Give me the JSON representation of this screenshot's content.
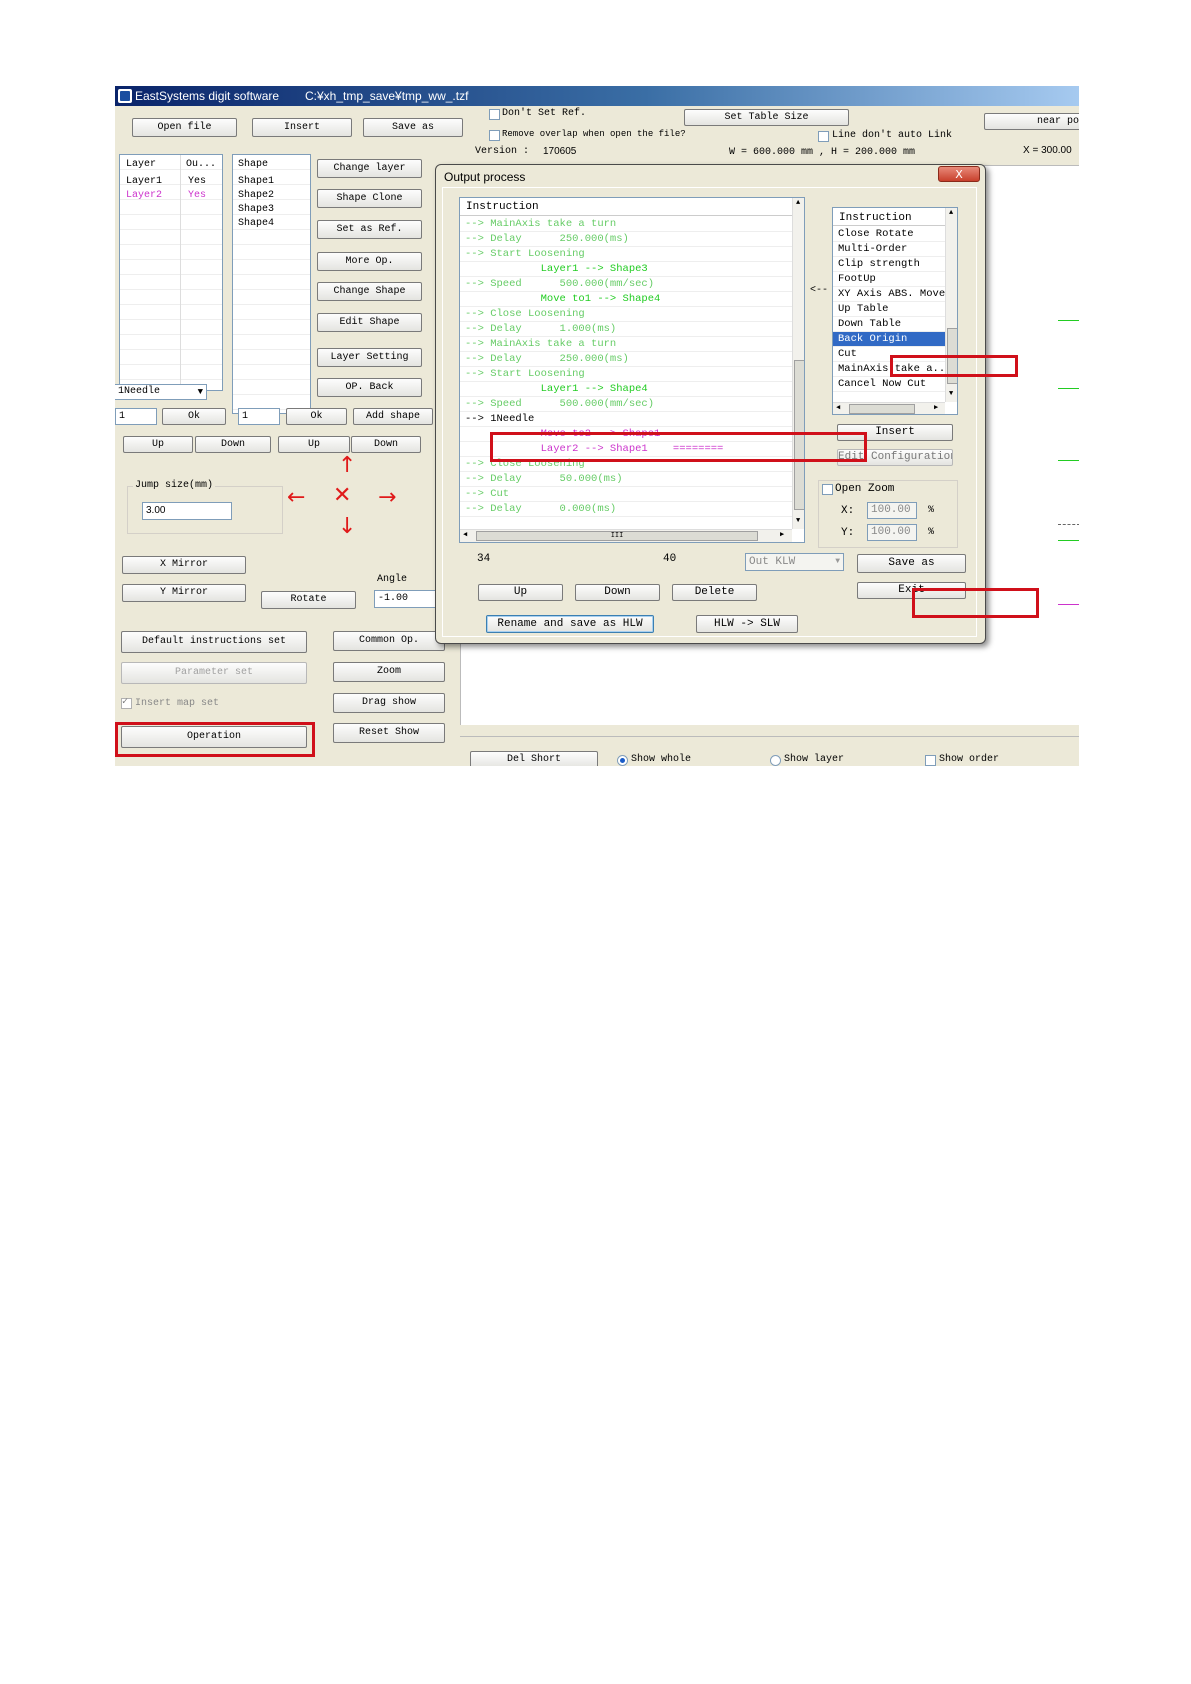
{
  "window": {
    "app_title": "EastSystems digit software",
    "file_path": "C:¥xh_tmp_save¥tmp_ww_.tzf"
  },
  "top": {
    "dont_set_ref": "Don't Set Ref.",
    "remove_overlap": "Remove overlap when open the file?",
    "set_table_size": "Set Table Size",
    "line_dont_auto_link": "Line don't auto Link",
    "near_btn": "near po",
    "version_label": "Version :",
    "version_value": "170605",
    "table_dims": "W = 600.000 mm , H = 200.000 mm",
    "x_value": "X = 300.00"
  },
  "toolbar": {
    "open_file": "Open file",
    "insert": "Insert",
    "save_as": "Save as"
  },
  "layers": {
    "col_layer": "Layer",
    "col_out": "Ou...",
    "rows": [
      {
        "name": "Layer1",
        "out": "Yes"
      },
      {
        "name": "Layer2",
        "out": "Yes"
      }
    ],
    "layer_color": "#000000",
    "layer2_color": "#cc33cc"
  },
  "shapes": {
    "col_shape": "Shape",
    "rows": [
      "Shape1",
      "Shape2",
      "Shape3",
      "Shape4"
    ]
  },
  "side_buttons": [
    "Change layer",
    "Shape Clone",
    "Set as Ref.",
    "More Op.",
    "Change Shape",
    "Edit Shape",
    "Layer Setting",
    "OP. Back"
  ],
  "needle_select": "1Needle",
  "count1": "1",
  "ok1": "Ok",
  "count2": "1",
  "ok2": "Ok",
  "add_shape": "Add shape",
  "up1": "Up",
  "down1": "Down",
  "up2": "Up",
  "down2": "Down",
  "jump": {
    "label": "Jump size(mm)",
    "value": "3.00"
  },
  "x_mirror": "X Mirror",
  "y_mirror": "Y Mirror",
  "rotate": "Rotate",
  "angle": {
    "label": "Angle",
    "value": "-1.00"
  },
  "bottom_left": {
    "default_instructions": "Default instructions set",
    "parameter_set": "Parameter set",
    "insert_map_set": "Insert map set",
    "operation": "Operation"
  },
  "bottom_mid": [
    "Common Op.",
    "Zoom",
    "Drag show",
    "Reset Show"
  ],
  "bottom_strip": {
    "del_short": "Del Short",
    "show_whole": "Show whole",
    "show_layer": "Show layer",
    "show_order": "Show order"
  },
  "dialog": {
    "title": "Output process",
    "close_label": "X",
    "instruction_header": "Instruction",
    "instructions": [
      {
        "text": "--> MainAxis take a turn",
        "color": "#66cc66"
      },
      {
        "text": "--> Delay      250.000(ms)",
        "color": "#66cc66"
      },
      {
        "text": "--> Start Loosening",
        "color": "#66cc66"
      },
      {
        "text": "            Layer1 --> Shape3",
        "color": "#22cc22"
      },
      {
        "text": "--> Speed      500.000(mm/sec)",
        "color": "#66cc66"
      },
      {
        "text": "            Move to1 --> Shape4",
        "color": "#22cc22"
      },
      {
        "text": "--> Close Loosening",
        "color": "#66cc66"
      },
      {
        "text": "--> Delay      1.000(ms)",
        "color": "#66cc66"
      },
      {
        "text": "--> MainAxis take a turn",
        "color": "#66cc66"
      },
      {
        "text": "--> Delay      250.000(ms)",
        "color": "#66cc66"
      },
      {
        "text": "--> Start Loosening",
        "color": "#66cc66"
      },
      {
        "text": "            Layer1 --> Shape4",
        "color": "#22cc22"
      },
      {
        "text": "--> Speed      500.000(mm/sec)",
        "color": "#66cc66"
      },
      {
        "text": "--> 1Needle",
        "color": "#000000"
      },
      {
        "text": "            Move to2 --> Shape1",
        "color": "#cc33cc"
      },
      {
        "text": "            Layer2 --> Shape1    ========",
        "color": "#cc33cc"
      },
      {
        "text": "--> Close Loosening",
        "color": "#66cc66"
      },
      {
        "text": "--> Delay      50.000(ms)",
        "color": "#66cc66"
      },
      {
        "text": "--> Cut",
        "color": "#66cc66"
      },
      {
        "text": "--> Delay      0.000(ms)",
        "color": "#66cc66"
      }
    ],
    "arrow_left": "<--",
    "right_header": "Instruction",
    "right_items": [
      "Close Rotate",
      "Multi-Order",
      "Clip strength",
      "FootUp",
      "XY Axis ABS. Move",
      "Up Table",
      "Down Table",
      "Back Origin",
      "Cut",
      "MainAxis take a...",
      "Cancel Now Cut"
    ],
    "selected_item": "Back Origin",
    "insert": "Insert",
    "edit_configuration": "Edit Configuration",
    "open_zoom": "Open Zoom",
    "x_label": "X:",
    "x_value": "100.00",
    "y_label": "Y:",
    "y_value": "100.00",
    "pct": "%",
    "count_a": "34",
    "count_b": "40",
    "out_select": "Out KLW",
    "save_as": "Save as",
    "exit": "Exit",
    "up": "Up",
    "down": "Down",
    "delete": "Delete",
    "rename_save": "Rename and save as HLW",
    "hlw_slw": "HLW  ->  SLW",
    "scroll_h_mid": "III"
  }
}
